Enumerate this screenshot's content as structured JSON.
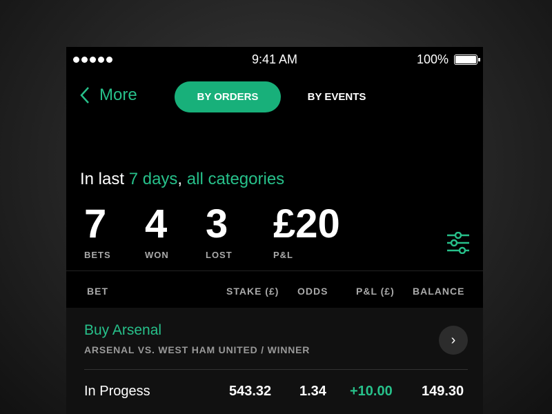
{
  "status_bar": {
    "time": "9:41 AM",
    "battery": "100%",
    "battery_level": 1.0
  },
  "nav": {
    "back_label": "More",
    "tabs": [
      {
        "label": "BY ORDERS",
        "active": true
      },
      {
        "label": "BY EVENTS",
        "active": false
      }
    ]
  },
  "summary": {
    "prefix": "In last ",
    "period": "7 days",
    "sep": ", ",
    "category": "all categories"
  },
  "stats": [
    {
      "value": "7",
      "label": "BETS"
    },
    {
      "value": "4",
      "label": "WON"
    },
    {
      "value": "3",
      "label": "LOST"
    },
    {
      "value": "£20",
      "label": "P&L"
    }
  ],
  "table": {
    "headers": [
      "BET",
      "STAKE (£)",
      "ODDS",
      "P&L (£)",
      "BALANCE"
    ],
    "rows": [
      {
        "title": "Buy Arsenal",
        "subtitle": "ARSENAL VS. WEST HAM UNITED / WINNER",
        "status": "In Progess",
        "stake": "543.32",
        "odds": "1.34",
        "pnl": "+10.00",
        "balance": "149.30"
      }
    ]
  },
  "colors": {
    "accent": "#27c08a",
    "background": "#000000"
  },
  "icons": {
    "filter": "sliders-icon",
    "back": "chevron-left-icon",
    "row": "chevron-right-icon"
  }
}
